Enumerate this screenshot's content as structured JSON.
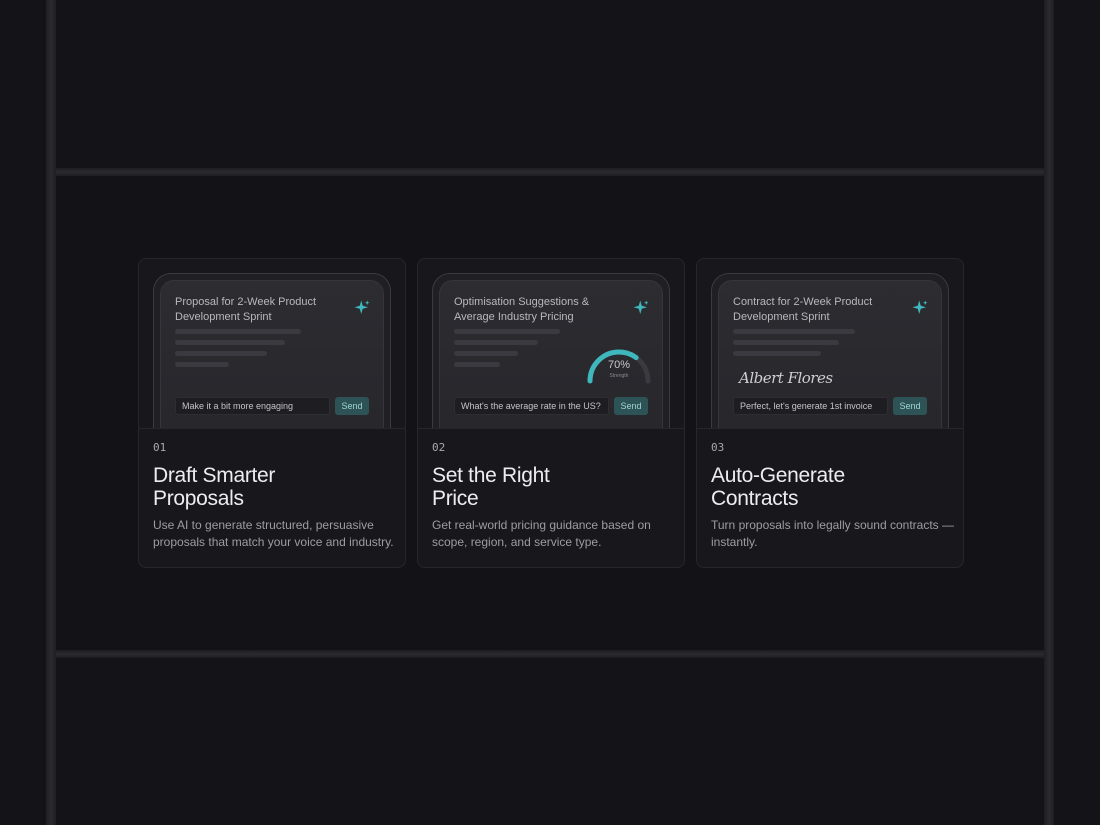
{
  "cards": [
    {
      "preview_title": "Proposal for 2-Week Product Development Sprint",
      "input_text": "Make it a bit more engaging",
      "send_label": "Send",
      "number": "01",
      "title": "Draft Smarter Proposals",
      "description": "Use AI to generate structured, persuasive proposals that match your voice and industry."
    },
    {
      "preview_title": "Optimisation Suggestions & Average Industry Pricing",
      "gauge_value": "70%",
      "gauge_label": "Strength",
      "gauge_fraction": 0.7,
      "input_text": "What's the average rate in the US?",
      "send_label": "Send",
      "number": "02",
      "title": "Set the Right Price",
      "description": "Get real-world pricing guidance based on scope, region, and service type."
    },
    {
      "preview_title": "Contract for 2-Week Product Development Sprint",
      "signature": "Albert Flores",
      "input_text": "Perfect, let's generate 1st invoice",
      "send_label": "Send",
      "number": "03",
      "title": "Auto-Generate Contracts",
      "description": "Turn proposals into legally sound contracts — instantly."
    }
  ],
  "colors": {
    "accent": "#3fb8bd",
    "background": "#141418",
    "card": "#18181c"
  },
  "icons": {
    "sparkle": "sparkle-icon"
  }
}
